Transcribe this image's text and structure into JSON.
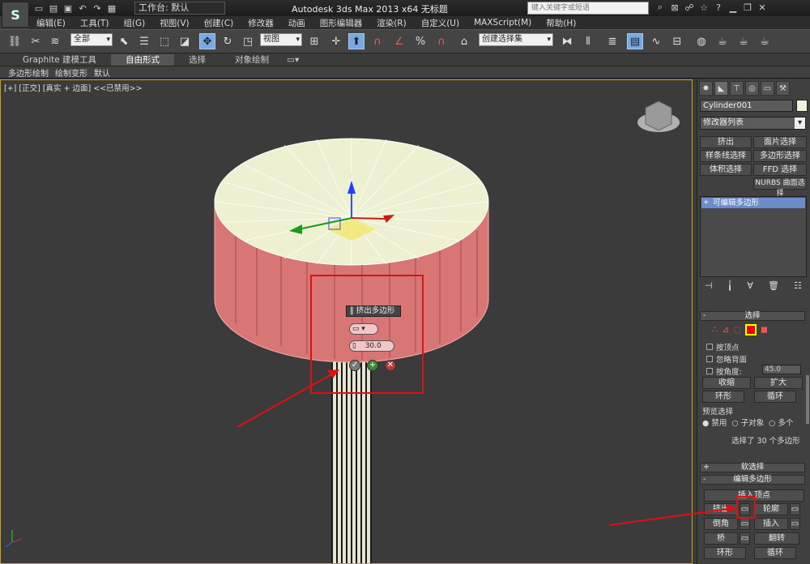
{
  "titlebar": {
    "logo": "S",
    "workspace_label": "工作台: 默认",
    "window_title": "Autodesk 3ds Max  2013 x64      无标题",
    "search_placeholder": "键入关键字或短语"
  },
  "menu": [
    "编辑(E)",
    "工具(T)",
    "组(G)",
    "视图(V)",
    "创建(C)",
    "修改器",
    "动画",
    "图形编辑器",
    "渲染(R)",
    "自定义(U)",
    "MAXScript(M)",
    "帮助(H)"
  ],
  "toolbar": {
    "selection_filter": "全部",
    "ref_coord": "视图",
    "named_selection": "创建选择集",
    "percent_snap": "%"
  },
  "ribbon": {
    "tabs": [
      "Graphite 建模工具",
      "自由形式",
      "选择",
      "对象绘制"
    ],
    "active_tab": "自由形式",
    "subtabs": [
      "多边形绘制",
      "绘制变形",
      "默认"
    ]
  },
  "viewport": {
    "label": "[+] [正交] [真实 + 边面] <<已禁用>>",
    "axis_z": "z",
    "caddy": {
      "title": "挤出多边形",
      "height_value": "30.0"
    }
  },
  "command_panel": {
    "object_name": "Cylinder001",
    "modifier_list": "修改器列表",
    "modifier_buttons": [
      "挤出",
      "面片选择",
      "样条线选择",
      "多边形选择",
      "体积选择",
      "FFD 选择",
      "NURBS 曲面选择"
    ],
    "stack_item": "可编辑多边形",
    "selection": {
      "title": "选择",
      "by_vertex": "按顶点",
      "ignore_backfacing": "忽略背面",
      "by_angle": "按角度:",
      "angle_value": "45.0",
      "shrink": "收缩",
      "grow": "扩大",
      "ring": "环形",
      "loop": "循环",
      "preview_title": "预览选择",
      "preview_options": [
        "禁用",
        "子对象",
        "多个"
      ],
      "status": "选择了 30 个多边形"
    },
    "soft_selection_title": "软选择",
    "edit_polygons": {
      "title": "编辑多边形",
      "insert_vertex": "插入顶点",
      "extrude": "挤出",
      "outline": "轮廓",
      "bevel": "倒角",
      "inset": "插入",
      "bridge": "桥",
      "flip": "翻转",
      "ring": "环形",
      "loop": "循环"
    }
  }
}
